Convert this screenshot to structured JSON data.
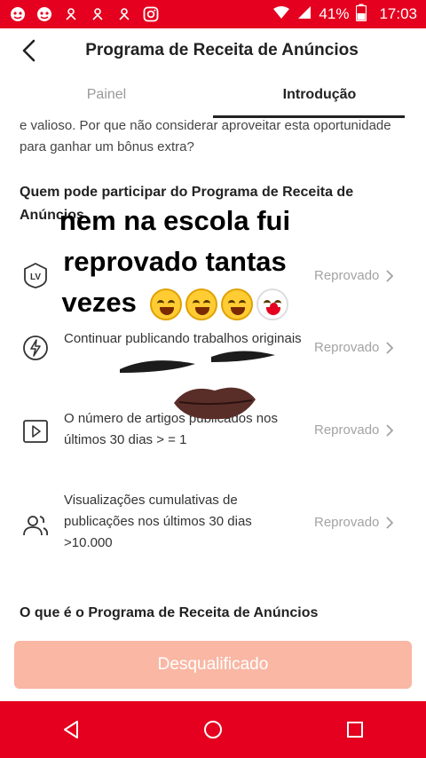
{
  "status_bar": {
    "battery_percent": "41%",
    "time": "17:03",
    "left_icons": [
      "app-icon",
      "app-icon",
      "notification-icon",
      "notification-icon",
      "notification-icon",
      "instagram-icon"
    ],
    "right_icons": [
      "wifi-icon",
      "signal-icon",
      "battery-icon"
    ],
    "color": "#e4001e"
  },
  "header": {
    "title": "Programa de Receita de Anúncios"
  },
  "tabs": [
    {
      "label": "Painel",
      "active": false
    },
    {
      "label": "Introdução",
      "active": true
    }
  ],
  "content": {
    "intro_text": "e valioso. Por que não considerar aproveitar esta oportunidade para ganhar um bônus extra?",
    "who_title": "Quem pode participar do Programa de Receita de Anúncios",
    "requirements": [
      {
        "icon": "level-badge-icon",
        "text": "",
        "status": "Reprovado"
      },
      {
        "icon": "lightning-icon",
        "text": "Continuar publicando trabalhos originais",
        "status": "Reprovado"
      },
      {
        "icon": "play-icon",
        "text": "O número de artigos publicados nos últimos 30 dias > = 1",
        "status": "Reprovado"
      },
      {
        "icon": "users-icon",
        "text": "Visualizações cumulativas de publicações nos últimos 30 dias >10.000",
        "status": "Reprovado"
      }
    ],
    "what_title": "O que é o Programa de Receita de Anúncios"
  },
  "meme": {
    "caption": "nem na escola fui reprovado tantas vezes",
    "emojis": [
      "laughing-emoji",
      "laughing-emoji",
      "laughing-emoji",
      "clown-emoji"
    ]
  },
  "footer": {
    "button_label": "Desqualificado",
    "button_color": "#f9b7a4"
  },
  "nav_bar": {
    "buttons": [
      "back-triangle-icon",
      "home-circle-icon",
      "recents-square-icon"
    ]
  }
}
